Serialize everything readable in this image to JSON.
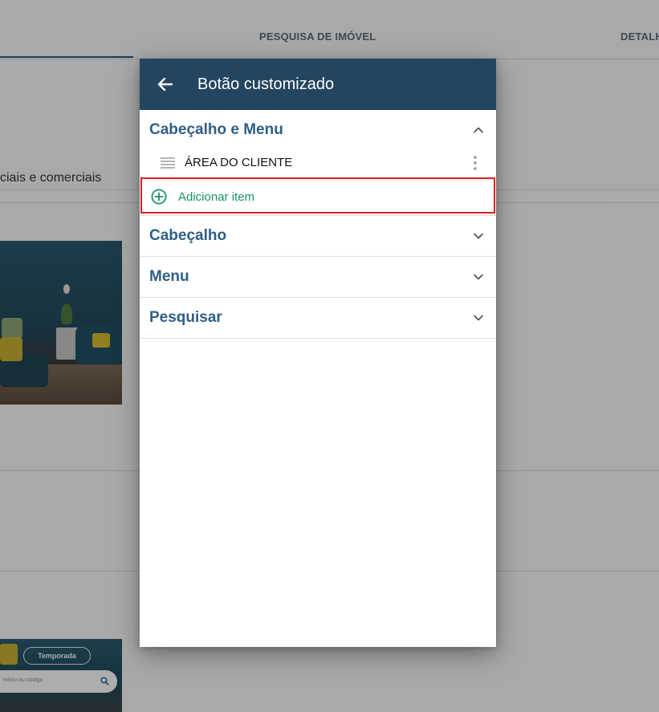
{
  "background": {
    "tabs": [
      {
        "label": "PESQUISA DE IMÓVEL"
      },
      {
        "label": "DETALH"
      }
    ],
    "section_label": "ciais e comerciais",
    "hero": {
      "pill_label": "Temporada",
      "search_placeholder": "mínio ou código"
    }
  },
  "dialog": {
    "title": "Botão customizado",
    "sections": [
      {
        "title": "Cabeçalho e Menu",
        "expanded": true,
        "items": [
          {
            "label": "ÁREA DO CLIENTE"
          }
        ],
        "add_label": "Adicionar item"
      },
      {
        "title": "Cabeçalho",
        "expanded": false
      },
      {
        "title": "Menu",
        "expanded": false
      },
      {
        "title": "Pesquisar",
        "expanded": false
      }
    ]
  },
  "colors": {
    "header_bg": "#234560",
    "section_title": "#2e5e86",
    "add_accent": "#17936d",
    "highlight_border": "#e11d1d"
  },
  "icons": {
    "back": "arrow-left-icon",
    "expanded": "chevron-up-icon",
    "collapsed": "chevron-down-icon",
    "drag": "drag-handle-icon",
    "more": "more-vertical-icon",
    "add": "plus-circle-icon",
    "search": "search-icon"
  }
}
